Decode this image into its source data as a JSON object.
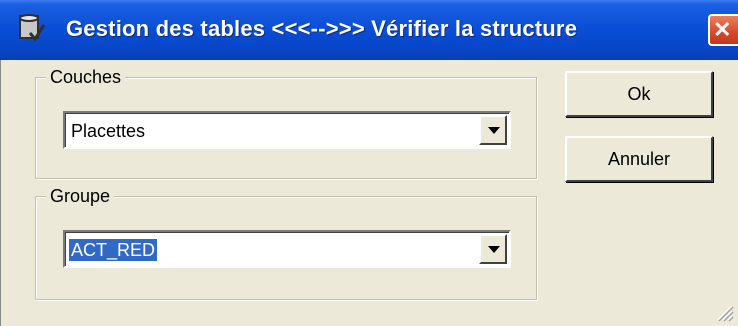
{
  "window": {
    "title": "Gestion des tables   <<<-->>>  Vérifier la structure",
    "close_symbol": "✕"
  },
  "couches": {
    "label": "Couches",
    "value": "Placettes"
  },
  "groupe": {
    "label": "Groupe",
    "value": "ACT_RED"
  },
  "buttons": {
    "ok": "Ok",
    "cancel": "Annuler"
  },
  "colors": {
    "titlebar": "#0a4fd6",
    "selection": "#316ac5",
    "close_button": "#d6482a",
    "dialog_bg": "#ece9d8"
  },
  "icons": {
    "title": "database-check-icon",
    "dropdown": "chevron-down-icon",
    "close": "close-icon",
    "resize": "resize-grip-icon"
  }
}
